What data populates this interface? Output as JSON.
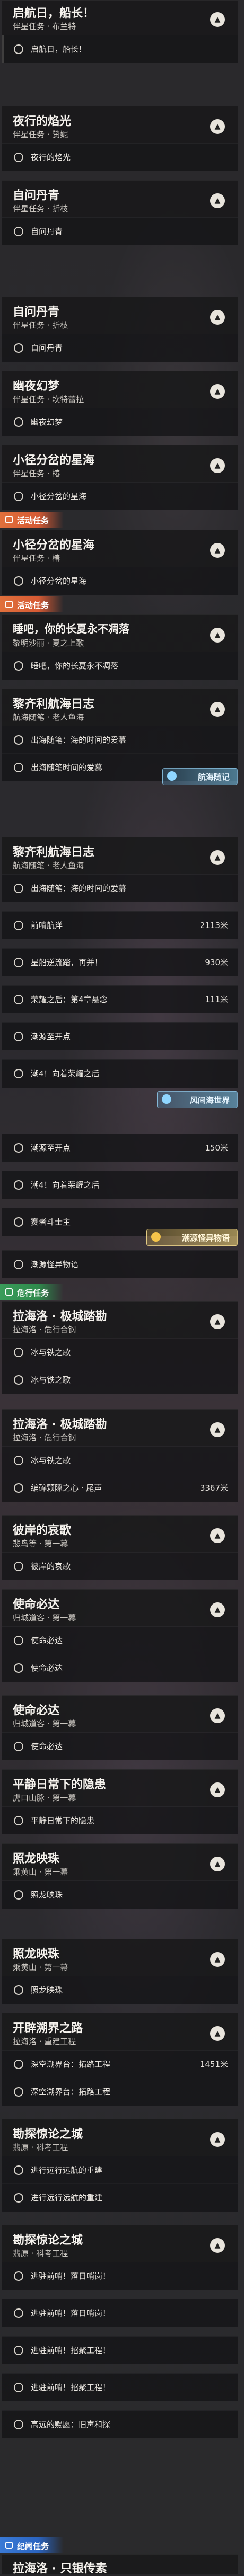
{
  "cards": {
    "c1": {
      "title": "启航日，船长！",
      "sub": "伴星任务 · 布兰特",
      "row": "启航日，船长！"
    },
    "c2": {
      "title": "夜行的焰光",
      "sub": "伴星任务 · 赞妮",
      "row": "夜行的焰光"
    },
    "c3": {
      "title": "自问丹青",
      "sub": "伴星任务 · 折枝",
      "row": "自问丹青"
    },
    "c4": {
      "title": "自问丹青",
      "sub": "伴星任务 · 折枝",
      "row": "自问丹青"
    },
    "c5": {
      "title": "幽夜幻梦",
      "sub": "伴星任务 · 坎特蕾拉",
      "row": "幽夜幻梦"
    },
    "c6": {
      "title": "小径分岔的星海",
      "sub": "伴星任务 · 椿",
      "row": "小径分岔的星海"
    },
    "c7": {
      "title": "小径分岔的星海",
      "sub": "伴星任务 · 椿",
      "row": "小径分岔的星海"
    },
    "c8": {
      "title": "睡吧，你的长夏永不凋落",
      "sub": "黎明沙丽 · 夏之上歌",
      "row": "睡吧，你的长夏永不凋落"
    },
    "c9": {
      "title": "黎齐利航海日志",
      "sub": "航海随笔 · 老人鱼海",
      "row": "出海随笔：海的时间的爱慕"
    },
    "c10": {
      "title": "黎齐利航海日志",
      "sub": "航海随笔 · 老人鱼海",
      "row": "出海随笔：海的时间的爱慕"
    },
    "c11": {
      "title": "拉海洛 · 极城踏勘",
      "sub": "拉海洛 · 危行合钢",
      "row": "冰与铁之歌"
    },
    "c12": {
      "title": "拉海洛 · 极城踏勘",
      "sub": "拉海洛 · 危行合钢",
      "row": "冰与铁之歌"
    },
    "c13": {
      "title": "彼岸的哀歌",
      "sub": "悲鸟等 · 第一幕",
      "row": "彼岸的哀歌"
    },
    "c14": {
      "title": "使命必达",
      "sub": "归城道客 · 第一幕",
      "row": "使命必达"
    },
    "c15": {
      "title": "使命必达",
      "sub": "归城道客 · 第一幕",
      "row": "使命必达"
    },
    "c16": {
      "title": "平静日常下的隐患",
      "sub": "虎口山脉 · 第一幕",
      "row": "平静日常下的隐患"
    },
    "c17": {
      "title": "照龙映珠",
      "sub": "乘黄山 · 第一幕",
      "row": "照龙映珠"
    },
    "c18": {
      "title": "照龙映珠",
      "sub": "乘黄山 · 第一幕",
      "row": "照龙映珠"
    },
    "c19": {
      "title": "开辟溯界之路",
      "sub": "拉海洛 · 重建工程",
      "row": "深空溯界台：拓路工程"
    },
    "c20": {
      "title": "勘探惊论之城",
      "sub": "翡原 · 科考工程",
      "row": "进行远行远航的重建"
    },
    "c21": {
      "title": "勘探惊论之城",
      "sub": "翡原 · 科考工程",
      "row": "进驻前哨！落日哨岗！"
    },
    "c22": {
      "title": "拉海洛 · 只银传素",
      "sub": "",
      "row": ""
    }
  },
  "rows": {
    "r9b": "出海随笔时间的爱慕",
    "r10a": "前哨航洋",
    "r10b": "星船逆流踏，再并！",
    "r10c": "荣耀之后：第4章悬念",
    "r10d": "潮源至开点",
    "r10e": "潮4！向着荣耀之后",
    "r10f": "潮源至开点",
    "r10g": "潮4！向着荣耀之后",
    "r10h": "赛者斗士主",
    "r10i": "潮源怪异物语",
    "r11b": "冰与铁之歌",
    "r12b": "编碎颗隙之心 · 尾声",
    "r14b": "使命必达",
    "r15b": "使命必达",
    "r17b": "照龙映珠",
    "r19b": "深空溯界台：拓路工程",
    "r20b": "进行远行远航的重建",
    "r21b": "进驻前哨！落日哨岗！",
    "r21c": "进驻前哨！招聚工程！",
    "r21d": "进驻前哨！招聚工程！",
    "r21e": "高远的赐愿：旧声和探"
  },
  "dists": {
    "d1": "2113米",
    "d2": "930米",
    "d3": "111米",
    "d4": "150米",
    "d5": "3367米",
    "d6": "1451米"
  },
  "tags": {
    "activity": "活动任务",
    "activity2": "活动任务",
    "danger": "危行任务",
    "record": "纪闻任务"
  },
  "banners": {
    "b1": "航海随记",
    "b2": "风间海世界",
    "b3": "潮源怪异物语"
  }
}
